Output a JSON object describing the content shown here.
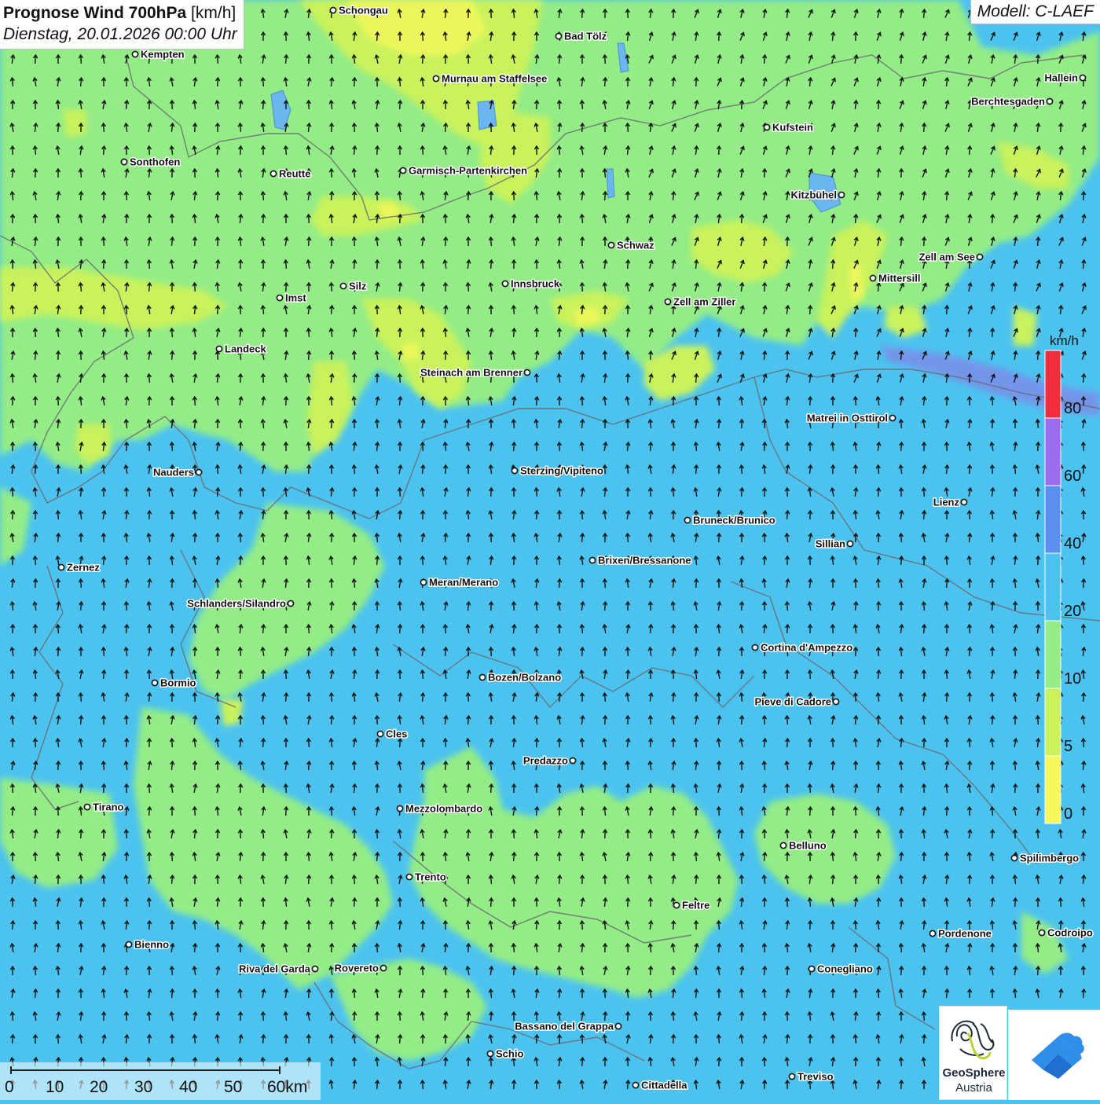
{
  "header": {
    "title_bold": "Prognose Wind 700hPa",
    "title_unit": "[km/h]",
    "datetime": "Dienstag, 20.01.2026 00:00 Uhr",
    "model": "Modell: C-LAEF"
  },
  "legend": {
    "unit": "km/h",
    "levels": [
      {
        "label": "0",
        "color": "#f8f85c"
      },
      {
        "label": "5",
        "color": "#c9f25c"
      },
      {
        "label": "10",
        "color": "#93ec86"
      },
      {
        "label": "20",
        "color": "#4cc3ef"
      },
      {
        "label": "40",
        "color": "#5b8ff0"
      },
      {
        "label": "60",
        "color": "#9c6cf0"
      },
      {
        "label": "80",
        "color": "#f02e3b"
      }
    ]
  },
  "scalebar": {
    "labels": [
      "0",
      "10",
      "20",
      "30",
      "40",
      "50",
      "60km"
    ]
  },
  "cities": [
    {
      "name": "Schongau"
    },
    {
      "name": "Bad Tölz"
    },
    {
      "name": "Kempten"
    },
    {
      "name": "Murnau am Staffelsee"
    },
    {
      "name": "Hallein"
    },
    {
      "name": "Berchtesgaden"
    },
    {
      "name": "Kufstein"
    },
    {
      "name": "Sonthofen"
    },
    {
      "name": "Reutte"
    },
    {
      "name": "Garmisch-Partenkirchen"
    },
    {
      "name": "Kitzbühel"
    },
    {
      "name": "Schwaz"
    },
    {
      "name": "Zell am See"
    },
    {
      "name": "Mittersill"
    },
    {
      "name": "Imst"
    },
    {
      "name": "Silz"
    },
    {
      "name": "Innsbruck"
    },
    {
      "name": "Zell am Ziller"
    },
    {
      "name": "Landeck"
    },
    {
      "name": "Steinach am Brenner"
    },
    {
      "name": "Matrei in Osttirol"
    },
    {
      "name": "Nauders"
    },
    {
      "name": "Sterzing/Vipiteno"
    },
    {
      "name": "Lienz"
    },
    {
      "name": "Bruneck/Brunico"
    },
    {
      "name": "Sillian"
    },
    {
      "name": "Zernez"
    },
    {
      "name": "Brixen/Bressanone"
    },
    {
      "name": "Meran/Merano"
    },
    {
      "name": "Schlanders/Silandro"
    },
    {
      "name": "Cortina d'Ampezzo"
    },
    {
      "name": "Bozen/Bolzano"
    },
    {
      "name": "Bormio"
    },
    {
      "name": "Pieve di Cadore"
    },
    {
      "name": "Cles"
    },
    {
      "name": "Predazzo"
    },
    {
      "name": "Tirano"
    },
    {
      "name": "Mezzolombardo"
    },
    {
      "name": "Belluno"
    },
    {
      "name": "Spilimbergo"
    },
    {
      "name": "Trento"
    },
    {
      "name": "Feltre"
    },
    {
      "name": "Pordenone"
    },
    {
      "name": "Codroipo"
    },
    {
      "name": "Bienno"
    },
    {
      "name": "Riva del Garda"
    },
    {
      "name": "Rovereto"
    },
    {
      "name": "Conegliano"
    },
    {
      "name": "Bassano del Grappa"
    },
    {
      "name": "Schio"
    },
    {
      "name": "Treviso"
    },
    {
      "name": "Cittadella"
    }
  ],
  "logo": {
    "line1": "GeoSphere",
    "line2": "Austria"
  }
}
